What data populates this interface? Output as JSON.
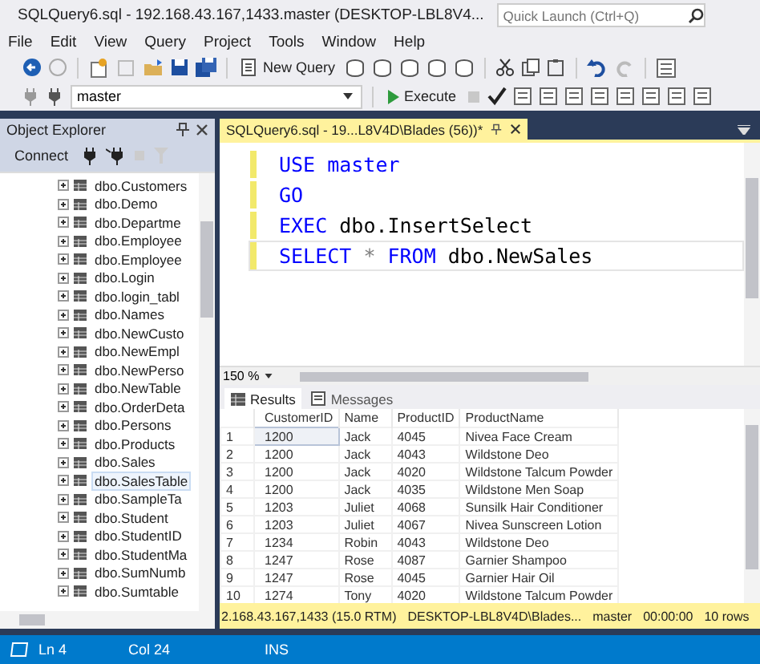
{
  "window": {
    "title": "SQLQuery6.sql - 192.168.43.167,1433.master (DESKTOP-LBL8V4...",
    "quick_launch": {
      "placeholder": "Quick Launch (Ctrl+Q)"
    }
  },
  "menu": [
    "File",
    "Edit",
    "View",
    "Query",
    "Project",
    "Tools",
    "Window",
    "Help"
  ],
  "toolbar": {
    "new_query": "New Query",
    "database": "master",
    "execute": "Execute"
  },
  "object_explorer": {
    "title": "Object Explorer",
    "connect": "Connect",
    "items": [
      {
        "label": "dbo.Customers",
        "selected": false
      },
      {
        "label": "dbo.Demo",
        "selected": false
      },
      {
        "label": "dbo.Departme",
        "selected": false
      },
      {
        "label": "dbo.Employee",
        "selected": false
      },
      {
        "label": "dbo.Employee",
        "selected": false
      },
      {
        "label": "dbo.Login",
        "selected": false
      },
      {
        "label": "dbo.login_tabl",
        "selected": false
      },
      {
        "label": "dbo.Names",
        "selected": false
      },
      {
        "label": "dbo.NewCusto",
        "selected": false
      },
      {
        "label": "dbo.NewEmpl",
        "selected": false
      },
      {
        "label": "dbo.NewPerso",
        "selected": false
      },
      {
        "label": "dbo.NewTable",
        "selected": false
      },
      {
        "label": "dbo.OrderDeta",
        "selected": false
      },
      {
        "label": "dbo.Persons",
        "selected": false
      },
      {
        "label": "dbo.Products",
        "selected": false
      },
      {
        "label": "dbo.Sales",
        "selected": false
      },
      {
        "label": "dbo.SalesTable",
        "selected": true
      },
      {
        "label": "dbo.SampleTa",
        "selected": false
      },
      {
        "label": "dbo.Student",
        "selected": false
      },
      {
        "label": "dbo.StudentID",
        "selected": false
      },
      {
        "label": "dbo.StudentMa",
        "selected": false
      },
      {
        "label": "dbo.SumNumb",
        "selected": false
      },
      {
        "label": "dbo.Sumtable",
        "selected": false
      }
    ]
  },
  "editor": {
    "tab": "SQLQuery6.sql - 19...L8V4D\\Blades (56))*",
    "zoom": "150 %",
    "lines": [
      {
        "changed": true,
        "current": false,
        "tokens": [
          {
            "text": "USE",
            "kind": "keyword"
          },
          {
            "text": "master",
            "kind": "keyword"
          }
        ]
      },
      {
        "changed": true,
        "current": false,
        "tokens": [
          {
            "text": "GO",
            "kind": "keyword"
          }
        ]
      },
      {
        "changed": true,
        "current": false,
        "tokens": [
          {
            "text": "EXEC",
            "kind": "keyword"
          },
          {
            "text": "dbo.InsertSelect",
            "kind": "identifier"
          }
        ]
      },
      {
        "changed": true,
        "current": true,
        "tokens": [
          {
            "text": "SELECT",
            "kind": "keyword"
          },
          {
            "text": "*",
            "kind": "operator"
          },
          {
            "text": "FROM",
            "kind": "keyword"
          },
          {
            "text": "dbo.NewSales",
            "kind": "identifier"
          }
        ]
      }
    ]
  },
  "results": {
    "tabs": [
      {
        "label": "Results",
        "selected": true
      },
      {
        "label": "Messages",
        "selected": false
      }
    ],
    "columns": [
      "CustomerID",
      "Name",
      "ProductID",
      "ProductName"
    ],
    "rows": [
      {
        "number": "1",
        "selected": true,
        "cells": [
          "1200",
          "Jack",
          "4045",
          "Nivea Face Cream"
        ]
      },
      {
        "number": "2",
        "selected": false,
        "cells": [
          "1200",
          "Jack",
          "4043",
          "Wildstone Deo"
        ]
      },
      {
        "number": "3",
        "selected": false,
        "cells": [
          "1200",
          "Jack",
          "4020",
          "Wildstone Talcum Powder"
        ]
      },
      {
        "number": "4",
        "selected": false,
        "cells": [
          "1200",
          "Jack",
          "4035",
          "Wildstone Men Soap"
        ]
      },
      {
        "number": "5",
        "selected": false,
        "cells": [
          "1203",
          "Juliet",
          "4068",
          "Sunsilk Hair Conditioner"
        ]
      },
      {
        "number": "6",
        "selected": false,
        "cells": [
          "1203",
          "Juliet",
          "4067",
          "Nivea Sunscreen Lotion"
        ]
      },
      {
        "number": "7",
        "selected": false,
        "cells": [
          "1234",
          "Robin",
          "4043",
          "Wildstone Deo"
        ]
      },
      {
        "number": "8",
        "selected": false,
        "cells": [
          "1247",
          "Rose",
          "4087",
          "Garnier Shampoo"
        ]
      },
      {
        "number": "9",
        "selected": false,
        "cells": [
          "1247",
          "Rose",
          "4045",
          "Garnier Hair Oil"
        ]
      },
      {
        "number": "10",
        "selected": false,
        "cells": [
          "1274",
          "Tony",
          "4020",
          "Wildstone Talcum Powder"
        ]
      }
    ]
  },
  "query_status": [
    "2.168.43.167,1433 (15.0 RTM)",
    "DESKTOP-LBL8V4D\\Blades...",
    "master",
    "00:00:00",
    "10 rows"
  ],
  "status_bar": {
    "line": "Ln 4",
    "column": "Col 24",
    "mode": "INS"
  }
}
